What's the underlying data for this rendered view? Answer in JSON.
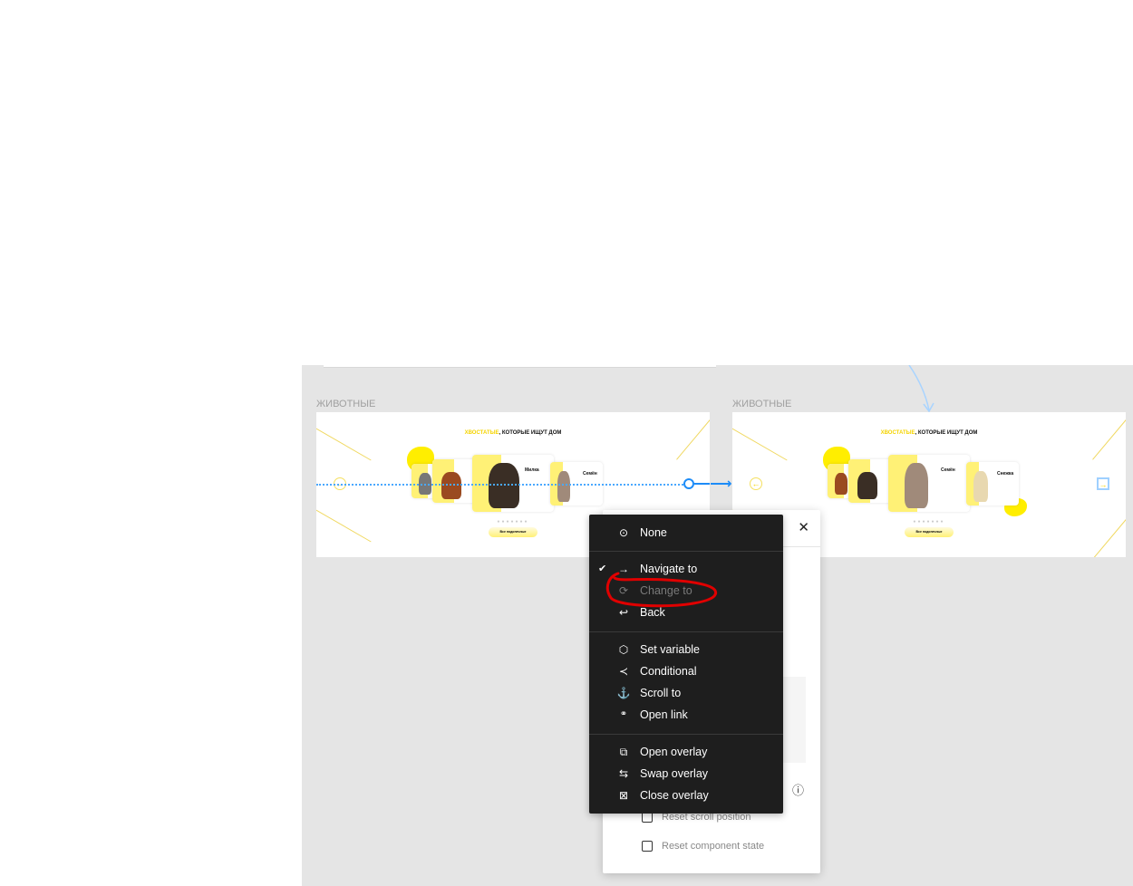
{
  "frames": [
    {
      "label": "ЖИВОТНЫЕ",
      "title_accent": "ХВОСТАТЫЕ",
      "title_rest": ", КОТОРЫЕ ИЩУТ ДОМ",
      "featured": "Милка",
      "side": "Семён",
      "dots": "●●●●●●●",
      "cta": "Все подопечные"
    },
    {
      "label": "ЖИВОТНЫЕ",
      "title_accent": "ХВОСТАТЫЕ",
      "title_rest": ", КОТОРЫЕ ИЩУТ ДОМ",
      "featured": "Семён",
      "side": "Снежка",
      "dots": "●●●●●●●",
      "cta": "Все подопечные"
    }
  ],
  "menu": {
    "items": [
      {
        "label": "None",
        "icon": "target-icon",
        "glyph": "⊙"
      },
      {
        "label": "Navigate to",
        "icon": "arrow-right-icon",
        "glyph": "→",
        "checked": true,
        "check": "✔"
      },
      {
        "label": "Change to",
        "icon": "swap-cycle-icon",
        "glyph": "⟳",
        "disabled": true
      },
      {
        "label": "Back",
        "icon": "back-arrow-icon",
        "glyph": "↩"
      },
      {
        "label": "Set variable",
        "icon": "variable-icon",
        "glyph": "⬡"
      },
      {
        "label": "Conditional",
        "icon": "branch-icon",
        "glyph": "≺"
      },
      {
        "label": "Scroll to",
        "icon": "anchor-icon",
        "glyph": "⚓"
      },
      {
        "label": "Open link",
        "icon": "link-icon",
        "glyph": "🔗"
      },
      {
        "label": "Open overlay",
        "icon": "open-overlay-icon",
        "glyph": "⧉"
      },
      {
        "label": "Swap overlay",
        "icon": "swap-overlay-icon",
        "glyph": "⇆"
      },
      {
        "label": "Close overlay",
        "icon": "close-overlay-icon",
        "glyph": "⊠"
      }
    ]
  },
  "panel": {
    "close": "✕",
    "info": "ⓘ",
    "reset_scroll": "Reset scroll position",
    "reset_component": "Reset component state"
  },
  "colors": {
    "accent": "#f5d400",
    "connector": "#4aa8ff",
    "annotation": "#e00000",
    "menu_bg": "#1e1e1e"
  }
}
